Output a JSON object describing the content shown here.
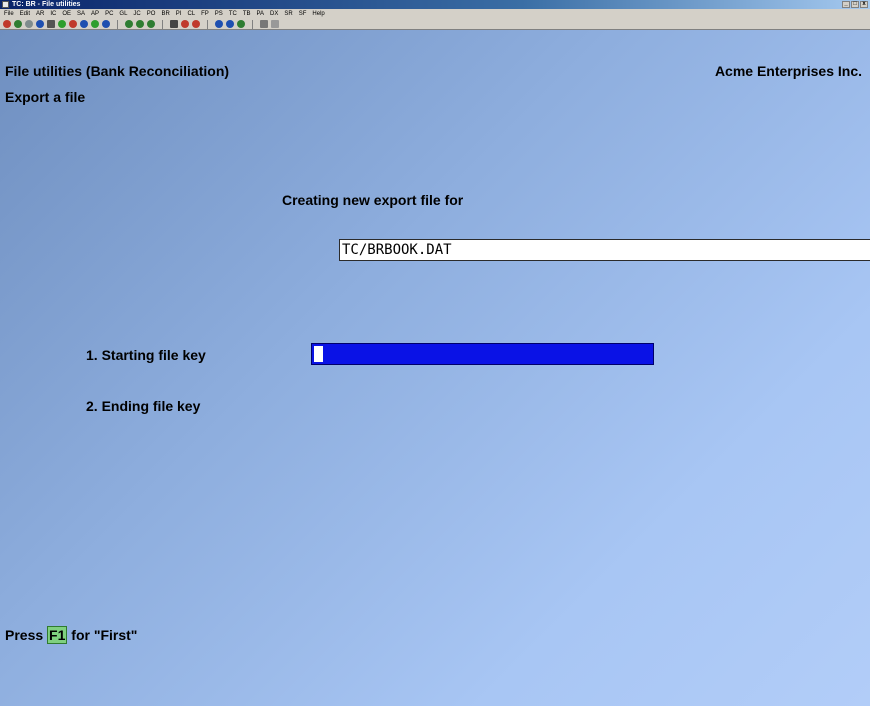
{
  "window": {
    "title": "TC: BR - File utilities",
    "min_label": "_",
    "max_label": "□",
    "close_label": "x"
  },
  "menu": [
    "File",
    "Edit",
    "AR",
    "IC",
    "OE",
    "SA",
    "AP",
    "PC",
    "GL",
    "JC",
    "PO",
    "BR",
    "PI",
    "CL",
    "FP",
    "PS",
    "TC",
    "TB",
    "PA",
    "DX",
    "SR",
    "SF",
    "Help"
  ],
  "toolbar_icons": [
    "exit-icon",
    "stop-icon",
    "settings-icon",
    "help-icon",
    "print-icon",
    "check-icon",
    "cancel-icon",
    "undo-icon",
    "up-arrow-icon",
    "down-arrow-icon",
    "circle-icon-1",
    "circle-icon-2",
    "circle-icon-3",
    "binoculars-icon",
    "search-icon",
    "refresh-icon",
    "back-icon",
    "forward-icon",
    "record-icon",
    "save-icon",
    "copy-icon"
  ],
  "screen": {
    "title": "File utilities (Bank Reconciliation)",
    "company": "Acme Enterprises Inc.",
    "subtitle": "Export a file",
    "creating_label": "Creating new export file for",
    "file_path": "TC/BRBOOK.DAT",
    "fields": [
      {
        "label": "1. Starting file key",
        "value": ""
      },
      {
        "label": "2. Ending file key",
        "value": ""
      }
    ],
    "hint_prefix": "Press",
    "hint_key": "F1",
    "hint_suffix": "for \"First\""
  },
  "colors": {
    "background": "#8eaede",
    "input_active": "#0a12e6",
    "fkey": "#7fd07f"
  }
}
